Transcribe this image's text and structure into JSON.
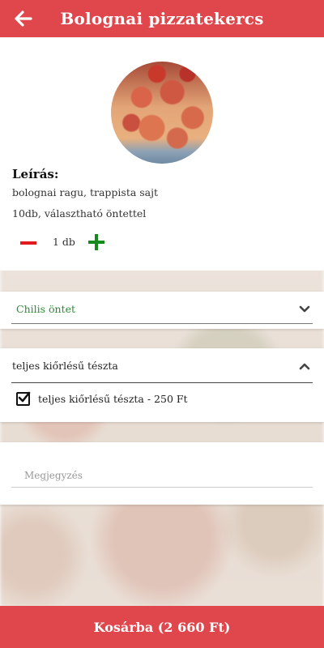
{
  "header": {
    "title": "Bolognai pizzatekercs",
    "back_icon": "arrow-left-icon"
  },
  "product": {
    "image": "pizza-rolls-photo",
    "description_title": "Leírás:",
    "description": "bolognai ragu, trappista sajt",
    "details": "10db, választható öntettel",
    "quantity": "1 db"
  },
  "options": {
    "sauce": {
      "selected": "Chilis öntet",
      "expanded": false,
      "label_color": "#2e8b36"
    },
    "pasta": {
      "selected": "teljes kiőrlésű tészta",
      "expanded": true,
      "items": [
        {
          "label": "teljes kiőrlésű tészta - 250 Ft",
          "checked": true
        }
      ]
    }
  },
  "note": {
    "placeholder": "Megjegyzés",
    "value": ""
  },
  "footer": {
    "cart_label": "Kosárba (2 660 Ft)"
  },
  "colors": {
    "accent": "#e0474d",
    "minus": "#e4191f",
    "plus": "#13891e"
  }
}
